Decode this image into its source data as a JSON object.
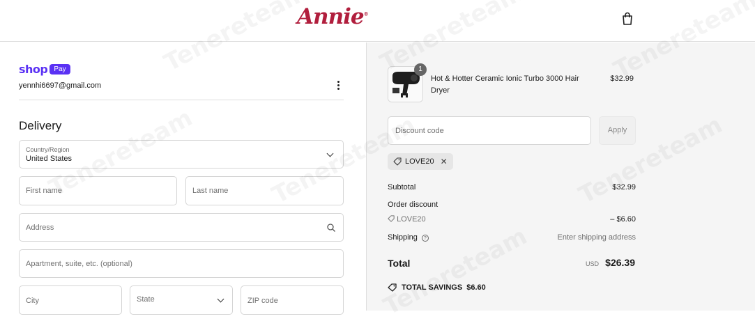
{
  "header": {
    "logo_text": "Annie",
    "logo_mark": "®",
    "brand_color": "#b11e3d",
    "cart_icon": "shopping-bag-icon"
  },
  "shop_pay": {
    "shop_word": "shop",
    "pay_word": "Pay",
    "color": "#5a31f4",
    "email": "yennhi6697@gmail.com"
  },
  "delivery": {
    "heading": "Delivery",
    "country_label": "Country/Region",
    "country_value": "United States",
    "first_name_placeholder": "First name",
    "last_name_placeholder": "Last name",
    "address_placeholder": "Address",
    "apartment_placeholder": "Apartment, suite, etc. (optional)",
    "city_placeholder": "City",
    "state_placeholder": "State",
    "zip_placeholder": "ZIP code"
  },
  "order": {
    "product": {
      "name": "Hot & Hotter Ceramic Ionic Turbo 3000 Hair Dryer",
      "price": "$32.99",
      "quantity": "1"
    },
    "discount_placeholder": "Discount code",
    "apply_label": "Apply",
    "applied_code": "LOVE20",
    "subtotal_label": "Subtotal",
    "subtotal_value": "$32.99",
    "order_discount_label": "Order discount",
    "discount_code": "LOVE20",
    "discount_value": "– $6.60",
    "shipping_label": "Shipping",
    "shipping_value": "Enter shipping address",
    "total_label": "Total",
    "currency": "USD",
    "total_value": "$26.39",
    "savings_label": "TOTAL SAVINGS",
    "savings_value": "$6.60"
  },
  "watermark": "Tenereteam"
}
